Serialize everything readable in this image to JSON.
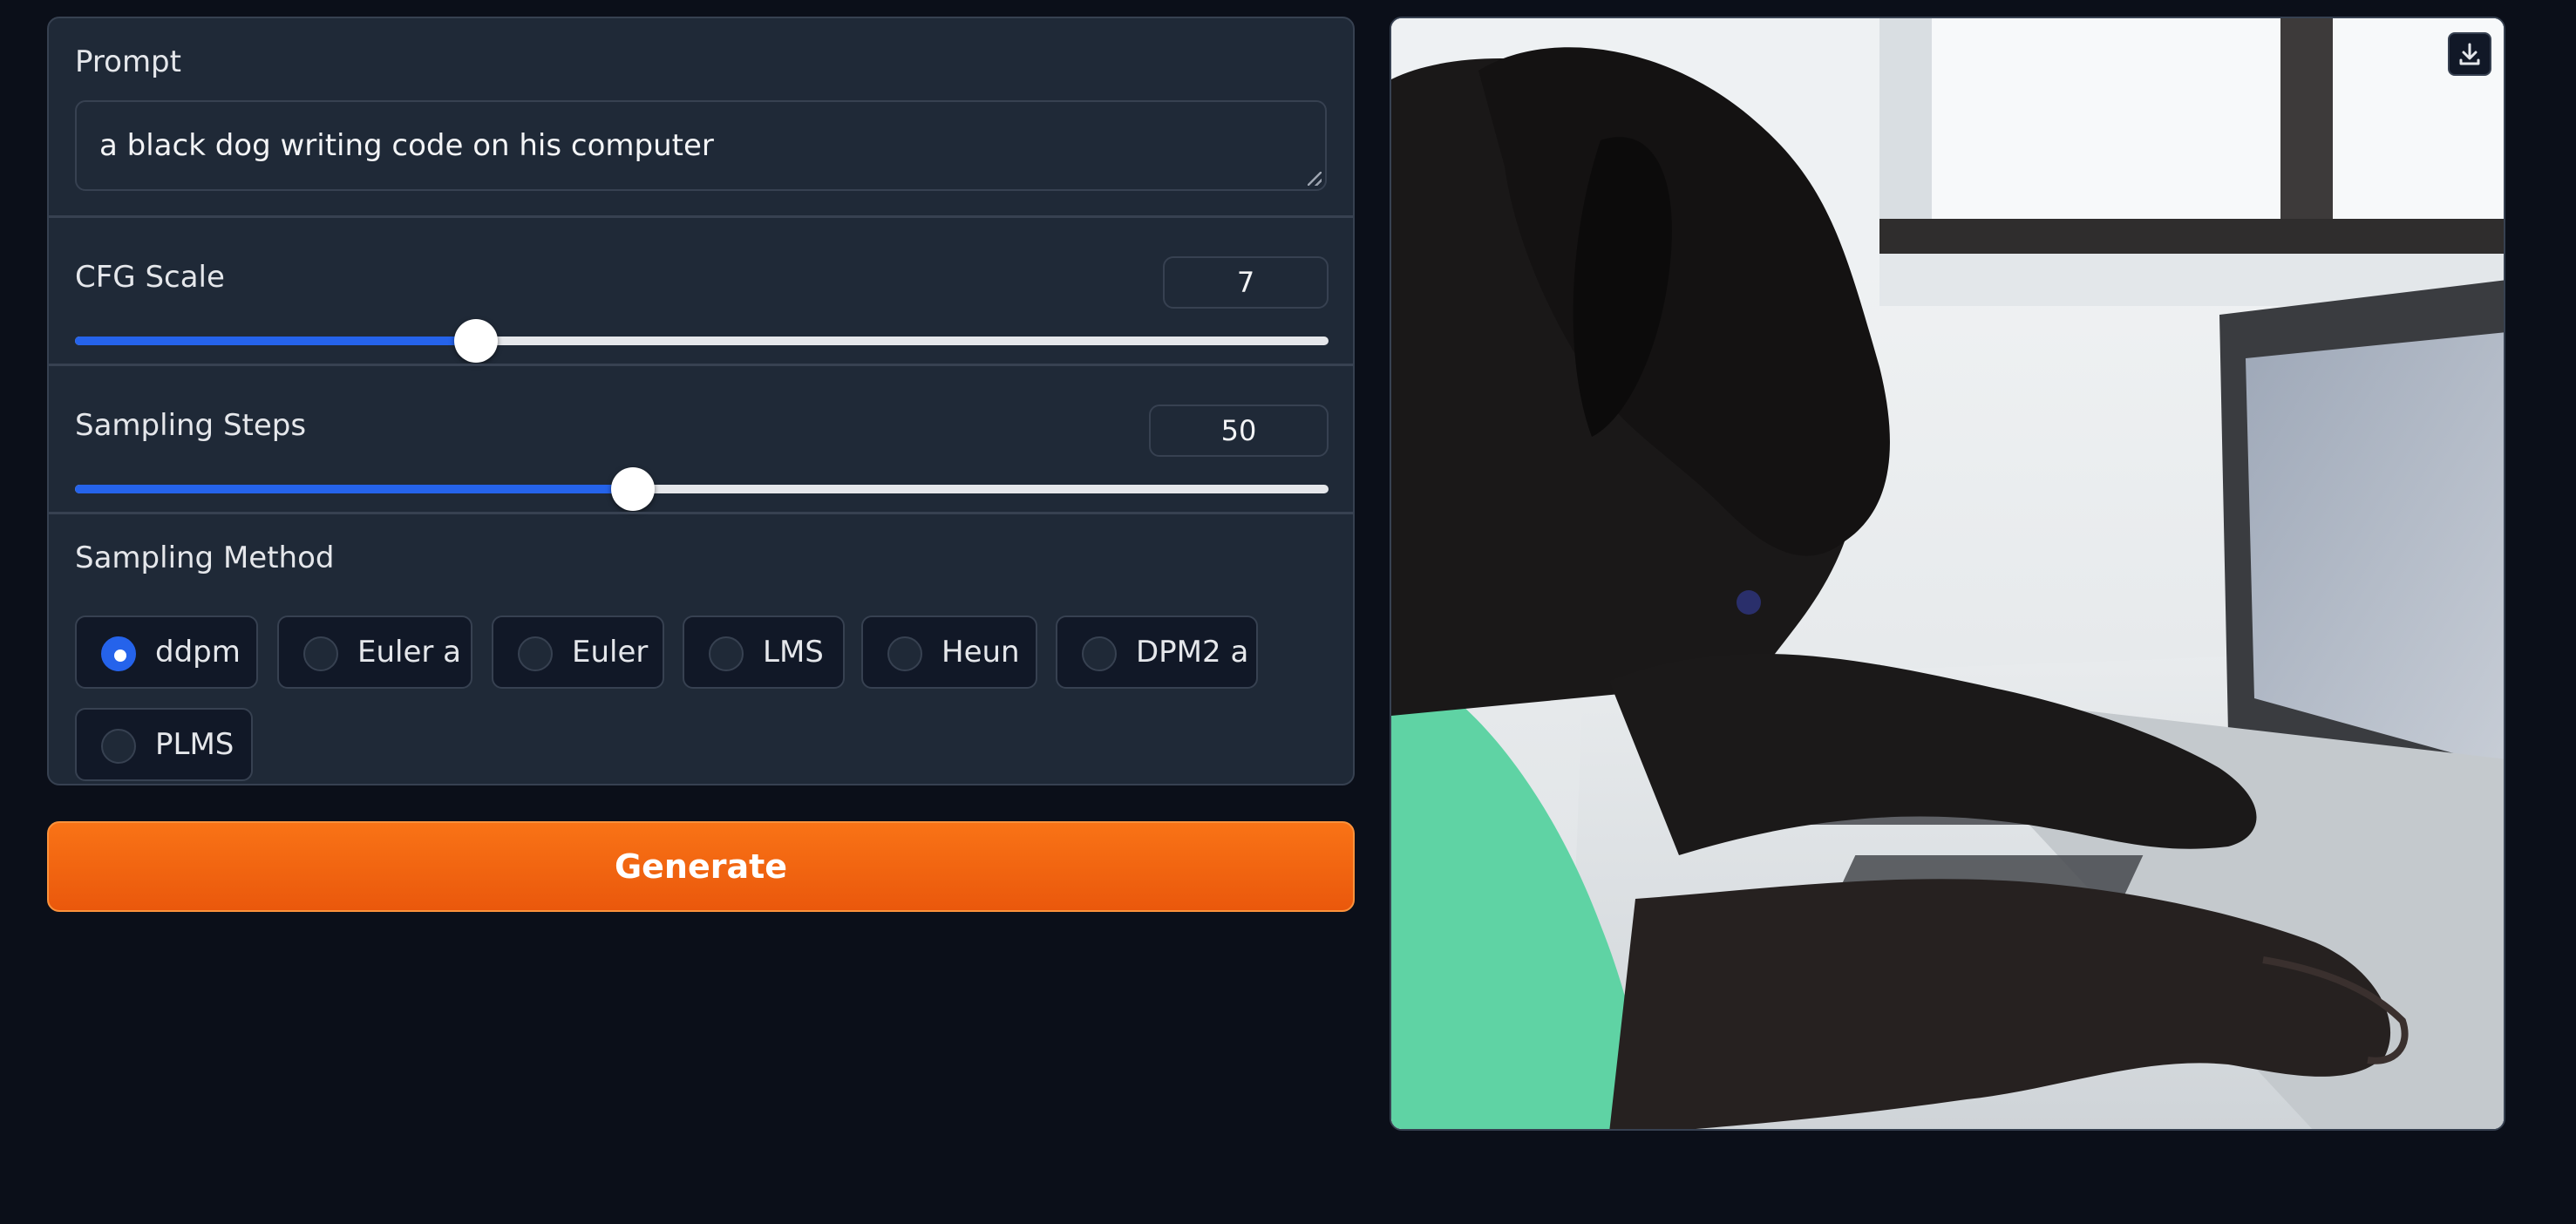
{
  "prompt": {
    "label": "Prompt",
    "value": "a black dog writing code on his computer"
  },
  "cfg_scale": {
    "label": "CFG Scale",
    "value": "7",
    "fill_fraction": 0.32
  },
  "sampling_steps": {
    "label": "Sampling Steps",
    "value": "50",
    "fill_fraction": 0.445
  },
  "sampling_method": {
    "label": "Sampling Method",
    "selected": "ddpm",
    "options": [
      "ddpm",
      "Euler a",
      "Euler",
      "LMS",
      "Heun",
      "DPM2 a",
      "PLMS"
    ]
  },
  "generate": {
    "label": "Generate"
  },
  "output_image": {
    "subject": "black dog typing on a laptop",
    "download_icon": "download-icon"
  },
  "colors": {
    "accent": "#2563eb",
    "generate": "#f97316",
    "panel": "#1f2937",
    "background": "#0b0f19"
  }
}
